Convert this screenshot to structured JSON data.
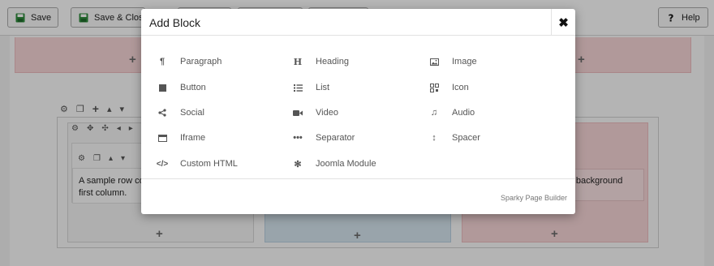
{
  "toolbar": {
    "save_label": "Save",
    "save_close_label": "Save & Close",
    "help_label": "Help"
  },
  "editor": {
    "sample_text_col1": "A sample row con first column.",
    "sample_text_col1_line1": "A sample row con",
    "sample_text_col1_line2": "first column.",
    "sample_text_col3": "t has background"
  },
  "modal": {
    "title": "Add Block",
    "close_glyph": "✖",
    "blocks": [
      {
        "label": "Paragraph",
        "icon": "paragraph-icon"
      },
      {
        "label": "Heading",
        "icon": "heading-icon"
      },
      {
        "label": "Image",
        "icon": "image-icon"
      },
      {
        "label": "Button",
        "icon": "button-icon"
      },
      {
        "label": "List",
        "icon": "list-icon"
      },
      {
        "label": "Icon",
        "icon": "icon-icon"
      },
      {
        "label": "Social",
        "icon": "share-icon"
      },
      {
        "label": "Video",
        "icon": "video-icon"
      },
      {
        "label": "Audio",
        "icon": "music-icon"
      },
      {
        "label": "Iframe",
        "icon": "iframe-icon"
      },
      {
        "label": "Separator",
        "icon": "dots-icon"
      },
      {
        "label": "Spacer",
        "icon": "vertical-arrows-icon"
      },
      {
        "label": "Custom HTML",
        "icon": "code-icon"
      },
      {
        "label": "Joomla Module",
        "icon": "joomla-icon"
      }
    ],
    "footer_credit": "Sparky Page Builder"
  },
  "colors": {
    "pink_column": "#f5d5d6",
    "blue_column": "#d5e3ee",
    "save_icon_green": "#2e8b3c"
  }
}
